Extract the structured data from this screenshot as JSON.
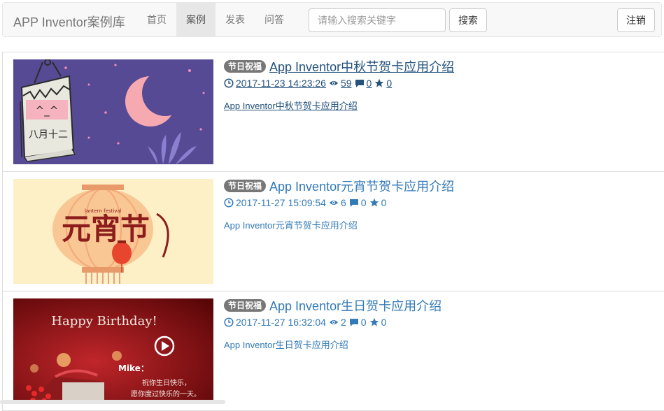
{
  "navbar": {
    "brand": "APP Inventor案例库",
    "nav": [
      "首页",
      "案例",
      "发表",
      "问答"
    ],
    "active_index": 1,
    "search_placeholder": "请输入搜索关键字",
    "search_label": "搜索",
    "logout_label": "注销"
  },
  "items": [
    {
      "badge": "节日祝福",
      "title": "App Inventor中秋节贺卡应用介绍",
      "time": "2017-11-23 14:23:26",
      "views": "59",
      "comments": "0",
      "stars": "0",
      "summary": "App Inventor中秋节贺卡应用介绍",
      "thumb_text": [
        "^_^",
        "八月十二"
      ]
    },
    {
      "badge": "节日祝福",
      "title": "App Inventor元宵节贺卡应用介绍",
      "time": "2017-11-27 15:09:54",
      "views": "6",
      "comments": "0",
      "stars": "0",
      "summary": "App Inventor元宵节贺卡应用介绍",
      "thumb_text": [
        "元宵节",
        "lantern festival"
      ]
    },
    {
      "badge": "节日祝福",
      "title": "App Inventor生日贺卡应用介绍",
      "time": "2017-11-27 16:32:04",
      "views": "2",
      "comments": "0",
      "stars": "0",
      "summary": "App Inventor生日贺卡应用介绍",
      "thumb_text": [
        "Happy Birthday!",
        "Mike：",
        "祝你生日快乐，",
        "愿你度过快乐的一天。"
      ]
    }
  ],
  "colors": {
    "link": "#337ab7",
    "badge": "#777777",
    "navbar_bg": "#f8f8f8"
  }
}
